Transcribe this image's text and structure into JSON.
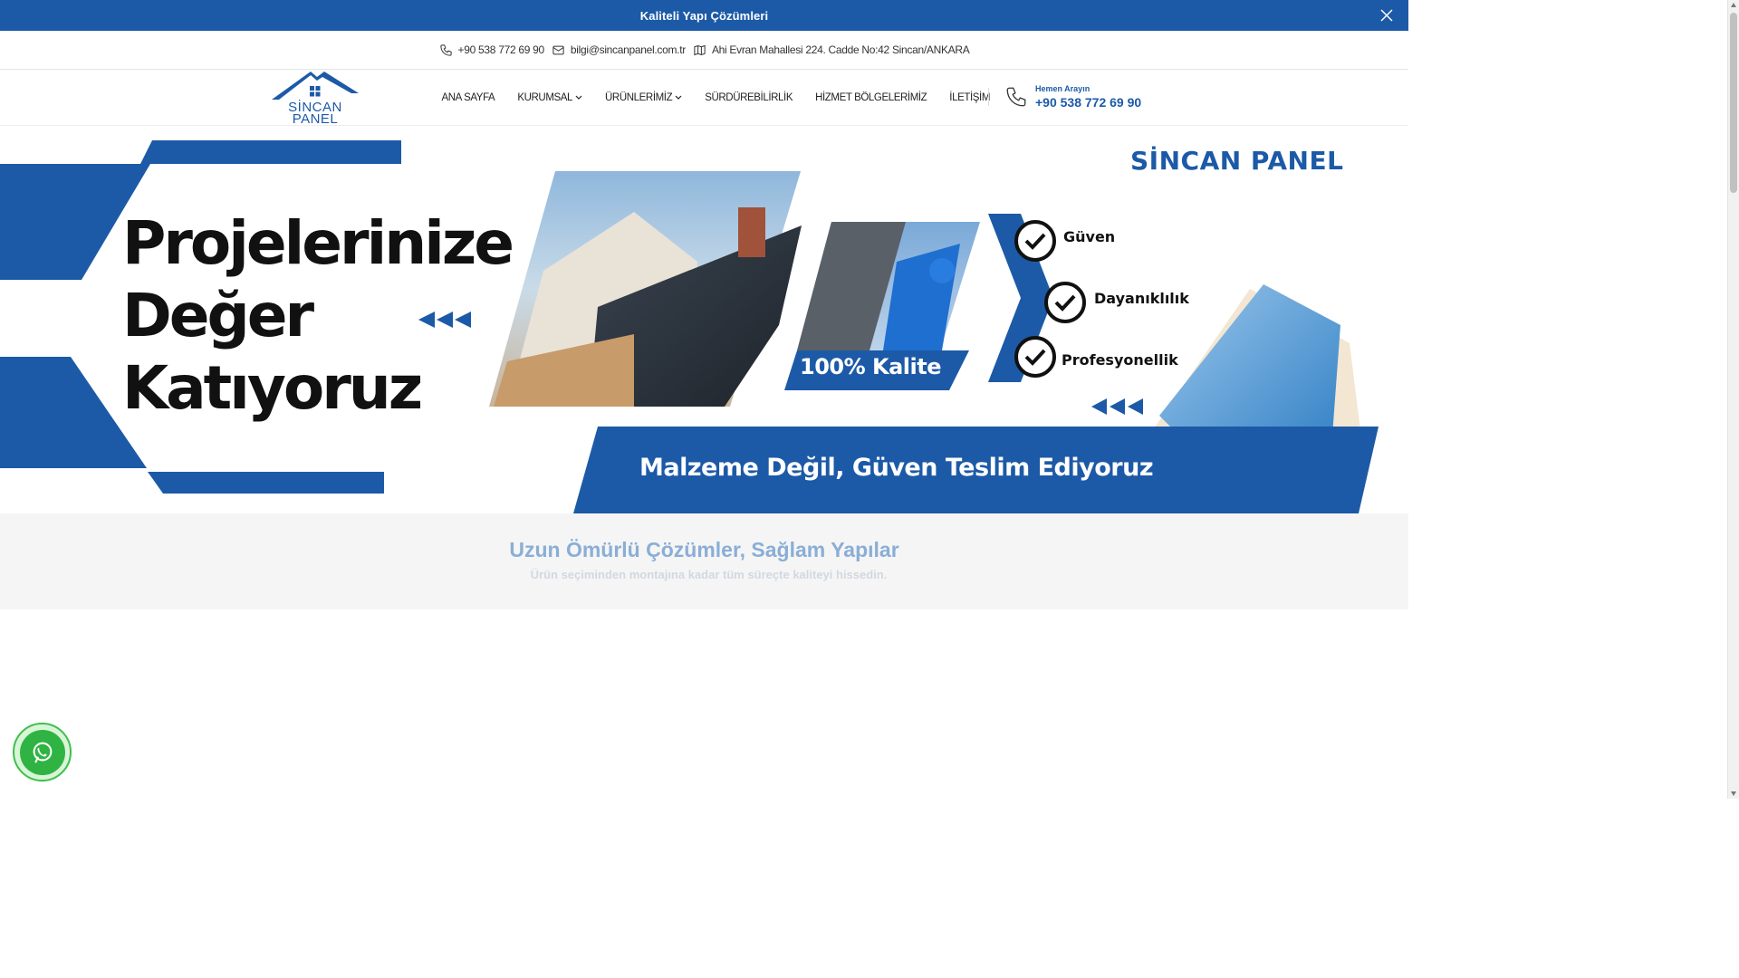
{
  "announcement": {
    "text": "Kaliteli Yapı Çözümleri"
  },
  "contact": {
    "phone": "+90 538 772 69 90",
    "email": "bilgi@sincanpanel.com.tr",
    "address": "Ahi Evran Mahallesi 224. Cadde No:42 Sincan/ANKARA"
  },
  "logo": {
    "line1": "SİNCAN",
    "line2": "PANEL"
  },
  "nav": {
    "items": [
      {
        "label": "ANA SAYFA",
        "dropdown": false
      },
      {
        "label": "KURUMSAL",
        "dropdown": true
      },
      {
        "label": "ÜRÜNLERİMİZ",
        "dropdown": true
      },
      {
        "label": "SÜRDÜREBİLİRLİK",
        "dropdown": false
      },
      {
        "label": "HİZMET BÖLGELERİMİZ",
        "dropdown": false
      },
      {
        "label": "İLETİŞİM",
        "dropdown": false
      }
    ]
  },
  "call": {
    "label": "Hemen Arayın",
    "number": "+90 538 772 69 90"
  },
  "hero": {
    "title_lines": [
      "Projelerinize",
      "Değer",
      "Katıyoruz"
    ],
    "brand": "SİNCAN PANEL",
    "quality_badge": "100% Kalite",
    "checks": [
      "Güven",
      "Dayanıklılık",
      "Profesyonellik"
    ],
    "slogan": "Malzeme Değil, Güven Teslim Ediyoruz"
  },
  "section": {
    "title": "Uzun Ömürlü Çözümler, Sağlam Yapılar",
    "subtitle": "Ürün seçiminden montajına kadar tüm süreçte kaliteyi hissedin."
  },
  "colors": {
    "brand_blue": "#1c5aa7",
    "whatsapp_green": "#2fb443"
  }
}
